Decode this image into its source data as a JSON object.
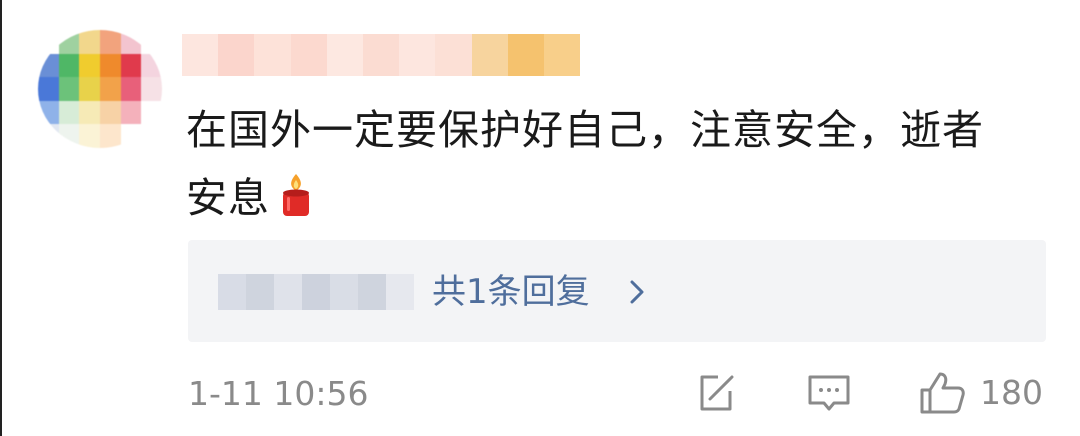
{
  "comment": {
    "line1": "在国外一定要保护好自己，注意安全，逝者",
    "line2": "安息",
    "emoji_icon": "candle-icon"
  },
  "reply_preview": {
    "label": "共1条回复",
    "chevron_icon": "chevron-right-icon"
  },
  "meta": {
    "timestamp": "1-11 10:56",
    "like_count": "180"
  },
  "actions": {
    "share_icon": "share-icon",
    "comment_icon": "comment-icon",
    "like_icon": "thumbs-up-icon"
  },
  "colors": {
    "text": "#1a1a1a",
    "muted": "#8a8a8a",
    "link": "#4f6e9c",
    "reply_bg": "#f3f4f6"
  }
}
